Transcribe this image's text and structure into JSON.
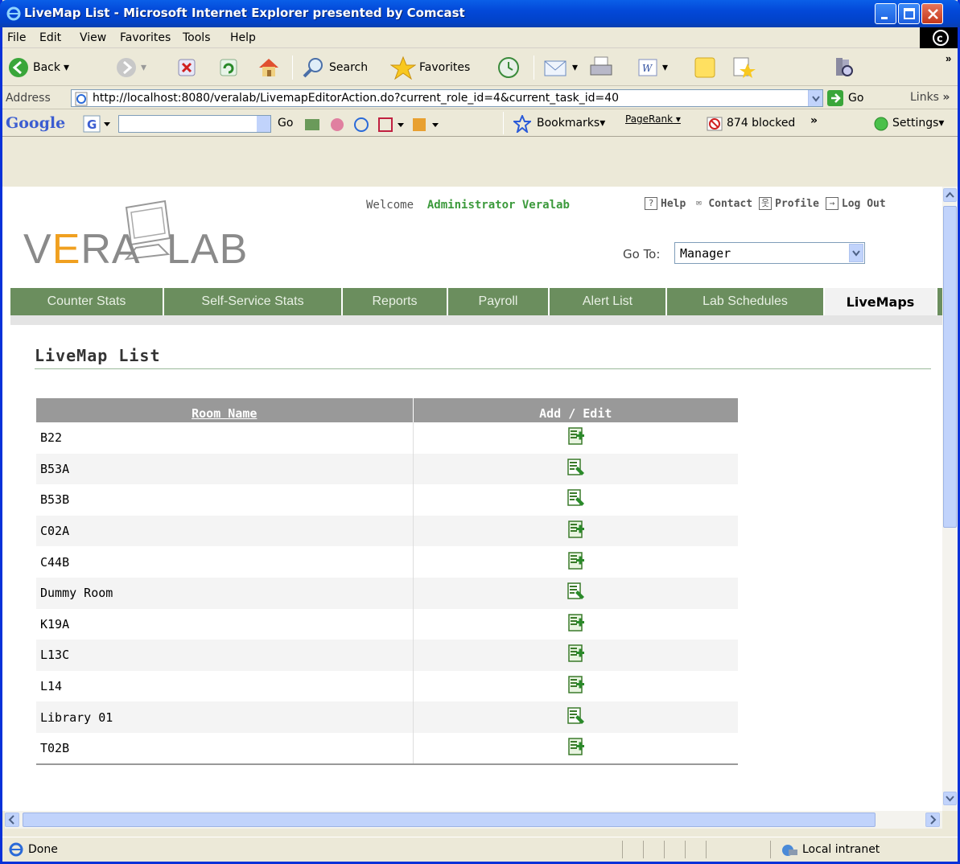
{
  "window": {
    "title": "LiveMap List - Microsoft Internet Explorer presented by Comcast"
  },
  "menu": [
    "File",
    "Edit",
    "View",
    "Favorites",
    "Tools",
    "Help"
  ],
  "toolbar": {
    "back_label": "Back",
    "search_label": "Search",
    "favorites_label": "Favorites"
  },
  "address": {
    "label": "Address",
    "url": "http://localhost:8080/veralab/LivemapEditorAction.do?current_role_id=4&current_task_id=40",
    "go_label": "Go",
    "links_label": "Links"
  },
  "googlebar": {
    "logo": "Google",
    "go_label": "Go",
    "bookmarks_label": "Bookmarks",
    "pagerank_label": "PageRank",
    "blocked_label": "874 blocked",
    "settings_label": "Settings"
  },
  "header": {
    "welcome_prefix": "Welcome",
    "user_name": "Administrator Veralab",
    "links": [
      {
        "glyph": "?",
        "label": "Help"
      },
      {
        "glyph": "✉",
        "label": "Contact"
      },
      {
        "glyph": "웃",
        "label": "Profile"
      },
      {
        "glyph": "→",
        "label": "Log Out"
      }
    ],
    "logo_left": "VERA",
    "logo_right": "LAB",
    "goto_label": "Go To:",
    "goto_value": "Manager"
  },
  "nav": {
    "tabs": [
      {
        "label": "Counter Stats",
        "active": false
      },
      {
        "label": "Self-Service Stats",
        "active": false
      },
      {
        "label": "Reports",
        "active": false
      },
      {
        "label": "Payroll",
        "active": false
      },
      {
        "label": "Alert List",
        "active": false
      },
      {
        "label": "Lab Schedules",
        "active": false
      },
      {
        "label": "LiveMaps",
        "active": true
      }
    ]
  },
  "main": {
    "heading": "LiveMap List",
    "table": {
      "columns": [
        "Room Name",
        "Add / Edit"
      ],
      "rows": [
        {
          "room": "B22",
          "action": "add"
        },
        {
          "room": "B53A",
          "action": "edit"
        },
        {
          "room": "B53B",
          "action": "edit"
        },
        {
          "room": "C02A",
          "action": "add"
        },
        {
          "room": "C44B",
          "action": "add"
        },
        {
          "room": "Dummy Room",
          "action": "edit"
        },
        {
          "room": "K19A",
          "action": "add"
        },
        {
          "room": "L13C",
          "action": "add"
        },
        {
          "room": "L14",
          "action": "add"
        },
        {
          "room": "Library 01",
          "action": "edit"
        },
        {
          "room": "T02B",
          "action": "add"
        }
      ]
    }
  },
  "status": {
    "text": "Done",
    "zone": "Local intranet"
  },
  "colors": {
    "nav_bg": "#6b8e5e",
    "accent_green": "#3c9a3c",
    "logo_orange": "#f0a020",
    "title_blue": "#0348d8"
  }
}
